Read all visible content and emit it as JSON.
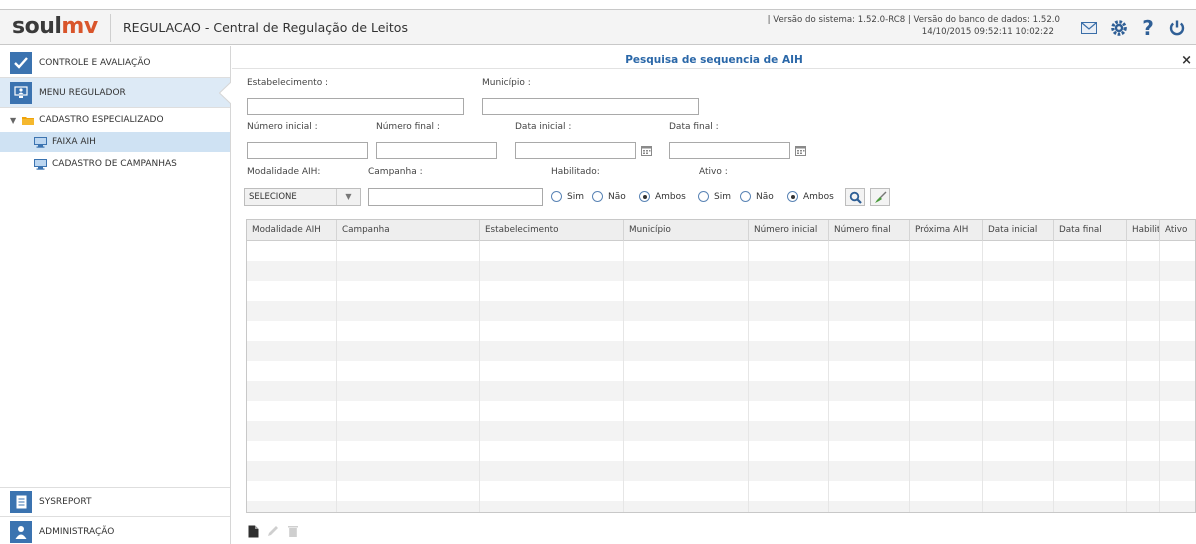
{
  "header": {
    "title": "REGULACAO - Central de Regulação de Leitos",
    "version_line1": "| Versão do sistema: 1.52.0-RC8 | Versão do banco de dados: 1.52.0",
    "version_line2": "14/10/2015 09:52:11   10:02:22",
    "icons": [
      "mail-icon",
      "gear-icon",
      "help-icon",
      "power-icon"
    ]
  },
  "sidebar": {
    "controle": "CONTROLE E AVALIAÇÃO",
    "menu": "MENU REGULADOR",
    "tree": {
      "group": "CADASTRO ESPECIALIZADO",
      "items": [
        {
          "label": "FAIXA AIH",
          "selected": true
        },
        {
          "label": "CADASTRO DE CAMPANHAS",
          "selected": false
        }
      ]
    },
    "sysreport": "SYSREPORT",
    "admin": "ADMINISTRAÇÃO"
  },
  "main": {
    "title": "Pesquisa de sequencia de AIH",
    "close": "×",
    "form": {
      "estabelecimento": "Estabelecimento :",
      "municipio": "Município :",
      "numero_inicial": "Número inicial :",
      "numero_final": "Número final :",
      "data_inicial": "Data inicial :",
      "data_final": "Data final :",
      "modalidade": "Modalidade AIH:",
      "campanha": "Campanha :",
      "habilitado": "Habilitado:",
      "ativo": "Ativo :",
      "modalidade_value": "SELECIONE",
      "radio_habilitado": {
        "options": [
          "Sim",
          "Não",
          "Ambos"
        ],
        "selected": "Ambos"
      },
      "radio_ativo": {
        "options": [
          "Sim",
          "Não",
          "Ambos"
        ],
        "selected": "Ambos"
      }
    },
    "table": {
      "columns": [
        "Modalidade AIH",
        "Campanha",
        "Estabelecimento",
        "Município",
        "Número inicial",
        "Número final",
        "Próxima AIH",
        "Data inicial",
        "Data final",
        "Habilitado",
        "Ativo"
      ],
      "rows": []
    }
  },
  "colors": {
    "title_blue": "#2a67a8",
    "logo_orange": "#d9552b",
    "selected_row": "#cfe2f3",
    "active_nav": "#ddeaf6"
  }
}
